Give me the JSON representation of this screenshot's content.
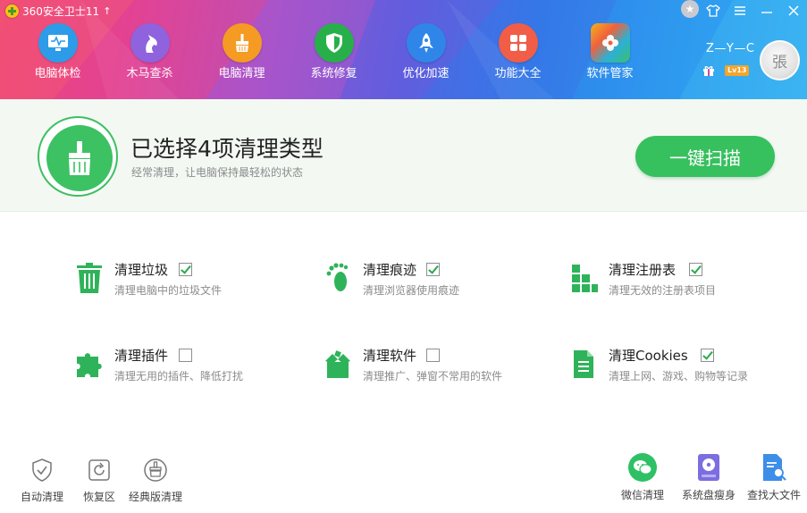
{
  "window": {
    "title": "360安全卫士11",
    "update_arrow": "↑"
  },
  "nav": {
    "items": [
      {
        "label": "电脑体检",
        "icon": "monitor-pulse-icon",
        "color": "#2c9ce9"
      },
      {
        "label": "木马查杀",
        "icon": "horse-icon",
        "color": "#8f63dd"
      },
      {
        "label": "电脑清理",
        "icon": "broom-icon",
        "color": "#f59a23"
      },
      {
        "label": "系统修复",
        "icon": "shield-icon",
        "color": "#27b04a"
      },
      {
        "label": "优化加速",
        "icon": "rocket-icon",
        "color": "#2f86e8"
      },
      {
        "label": "功能大全",
        "icon": "grid-icon",
        "color": "#f15d47"
      },
      {
        "label": "软件管家",
        "icon": "flower-icon",
        "color": "#1fa9c9"
      }
    ]
  },
  "user": {
    "name": "Z—Y—C",
    "level": "Lv13",
    "avatar_char": "張"
  },
  "banner": {
    "title": "已选择4项清理类型",
    "subtitle": "经常清理，让电脑保持最轻松的状态",
    "scan_button": "一键扫描"
  },
  "options": [
    {
      "title": "清理垃圾",
      "desc": "清理电脑中的垃圾文件",
      "checked": true,
      "icon": "trash-icon"
    },
    {
      "title": "清理痕迹",
      "desc": "清理浏览器使用痕迹",
      "checked": true,
      "icon": "footprint-icon"
    },
    {
      "title": "清理注册表",
      "desc": "清理无效的注册表项目",
      "checked": true,
      "icon": "registry-blocks-icon"
    },
    {
      "title": "清理插件",
      "desc": "清理无用的插件、降低打扰",
      "checked": false,
      "icon": "puzzle-icon"
    },
    {
      "title": "清理软件",
      "desc": "清理推广、弹窗不常用的软件",
      "checked": false,
      "icon": "open-box-icon"
    },
    {
      "title": "清理Cookies",
      "desc": "清理上网、游戏、购物等记录",
      "checked": true,
      "icon": "document-icon"
    }
  ],
  "bottom_left": [
    {
      "label": "自动清理",
      "icon": "shield-check-icon"
    },
    {
      "label": "恢复区",
      "icon": "restore-icon"
    },
    {
      "label": "经典版清理",
      "icon": "classic-clean-icon"
    }
  ],
  "bottom_right": [
    {
      "label": "微信清理",
      "icon": "wechat-icon",
      "color": "#2ec065"
    },
    {
      "label": "系统盘瘦身",
      "icon": "disk-icon",
      "color": "#7c6ee0"
    },
    {
      "label": "查找大文件",
      "icon": "file-search-icon",
      "color": "#3d8ee8"
    }
  ],
  "colors": {
    "accent_green": "#37c05e",
    "banner_bg": "#f3f8f3"
  }
}
